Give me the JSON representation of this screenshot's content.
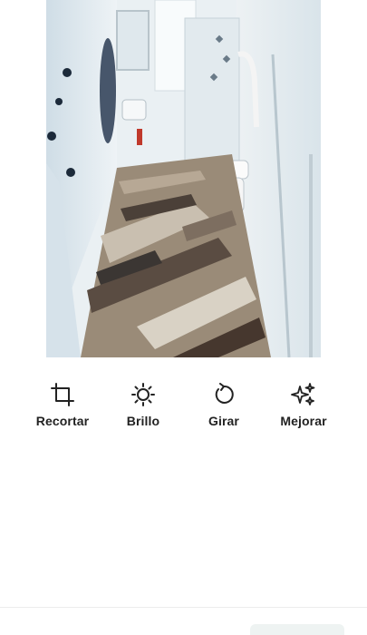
{
  "photo": {
    "subject": "bathroom-photo"
  },
  "tools": [
    {
      "label": "Recortar",
      "icon": "crop-icon"
    },
    {
      "label": "Brillo",
      "icon": "brightness-icon"
    },
    {
      "label": "Girar",
      "icon": "rotate-icon"
    },
    {
      "label": "Mejorar",
      "icon": "sparkles-icon"
    }
  ],
  "colors": {
    "text": "#222222",
    "background": "#ffffff"
  }
}
